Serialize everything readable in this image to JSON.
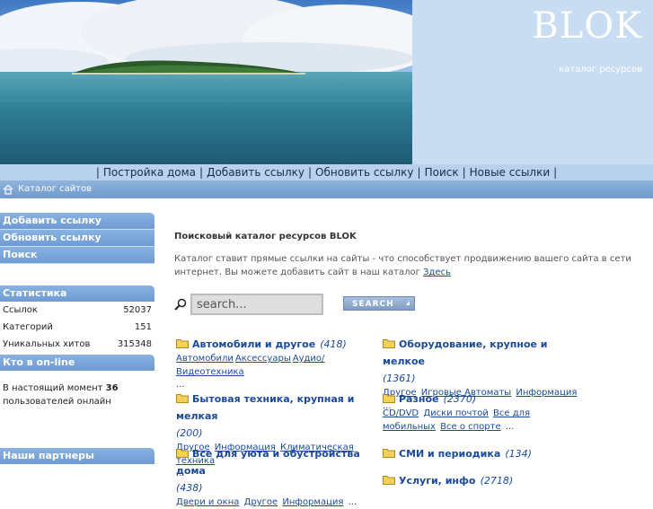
{
  "header": {
    "logo": "BLOK",
    "tagline": "каталог ресурсов"
  },
  "nav": {
    "items": [
      "Постройка дома",
      "Добавить ссылку",
      "Обновить ссылку",
      "Поиск",
      "Новые ссылки"
    ],
    "separator": "|"
  },
  "breadcrumb": {
    "label": "Каталог сайтов"
  },
  "sidebar": {
    "links": [
      "Добавить ссылку",
      "Обновить ссылку",
      "Поиск"
    ],
    "stats": {
      "title": "Статистика",
      "rows": [
        {
          "label": "Ссылок",
          "value": "52037"
        },
        {
          "label": "Категорий",
          "value": "151"
        },
        {
          "label": "Уникальных хитов",
          "value": "315348"
        }
      ]
    },
    "online": {
      "title": "Кто в on-line",
      "prefix": "В настоящий момент",
      "count": "36",
      "suffix": "пользователей онлайн"
    },
    "partners": {
      "title": "Наши партнеры"
    }
  },
  "main": {
    "title": "Поисковый каталог ресурсов BLOK",
    "desc": "Каталог ставит прямые ссылки на сайты - что способствует продвижению вашего сайта в сети интернет.  Вы можете добавить сайт в наш каталог",
    "desc_link": "Здесь",
    "search": {
      "placeholder": "search...",
      "button": "SEARCH"
    },
    "categories": [
      {
        "title": "Автомобили и другое",
        "count": "(418)",
        "subs": [
          "Автомобили",
          "Аксессуары",
          "Аудио/Видеотехника"
        ],
        "more": "..."
      },
      {
        "title": "Оборудование, крупное и мелкое",
        "count": "(1361)",
        "subs": [
          "Другое",
          "Игровые Автоматы",
          "Информация"
        ],
        "more": "..."
      },
      {
        "title": "Бытовая техника, крупная и мелкая",
        "count": "(200)",
        "subs": [
          "Другое",
          "Информация",
          "Климатическая техника"
        ],
        "more": "..."
      },
      {
        "title": "Разное",
        "count": "(2370)",
        "subs": [
          "CD/DVD",
          "Диски почтой",
          "Все для мобильных",
          "Все о спорте"
        ],
        "more": "..."
      },
      {
        "title": "Все для уюта и обустройства дома",
        "count": "(438)",
        "subs": [
          "Двери и окна",
          "Другое",
          "Информация"
        ],
        "more": "..."
      },
      {
        "title": "СМИ и периодика",
        "count": "(134)",
        "subs": [],
        "more": ""
      },
      {
        "title": "Услуги, инфо",
        "count": "(2718)",
        "subs": [],
        "more": ""
      }
    ]
  },
  "colors": {
    "header_bg": "#c9ddf2",
    "nav_bg": "#b8d2ee",
    "sidebar_head": "#7ea7da",
    "link": "#1a4a9a"
  },
  "icons": {
    "home": "home-icon",
    "search": "magnifier-icon",
    "folder": "folder-icon"
  }
}
